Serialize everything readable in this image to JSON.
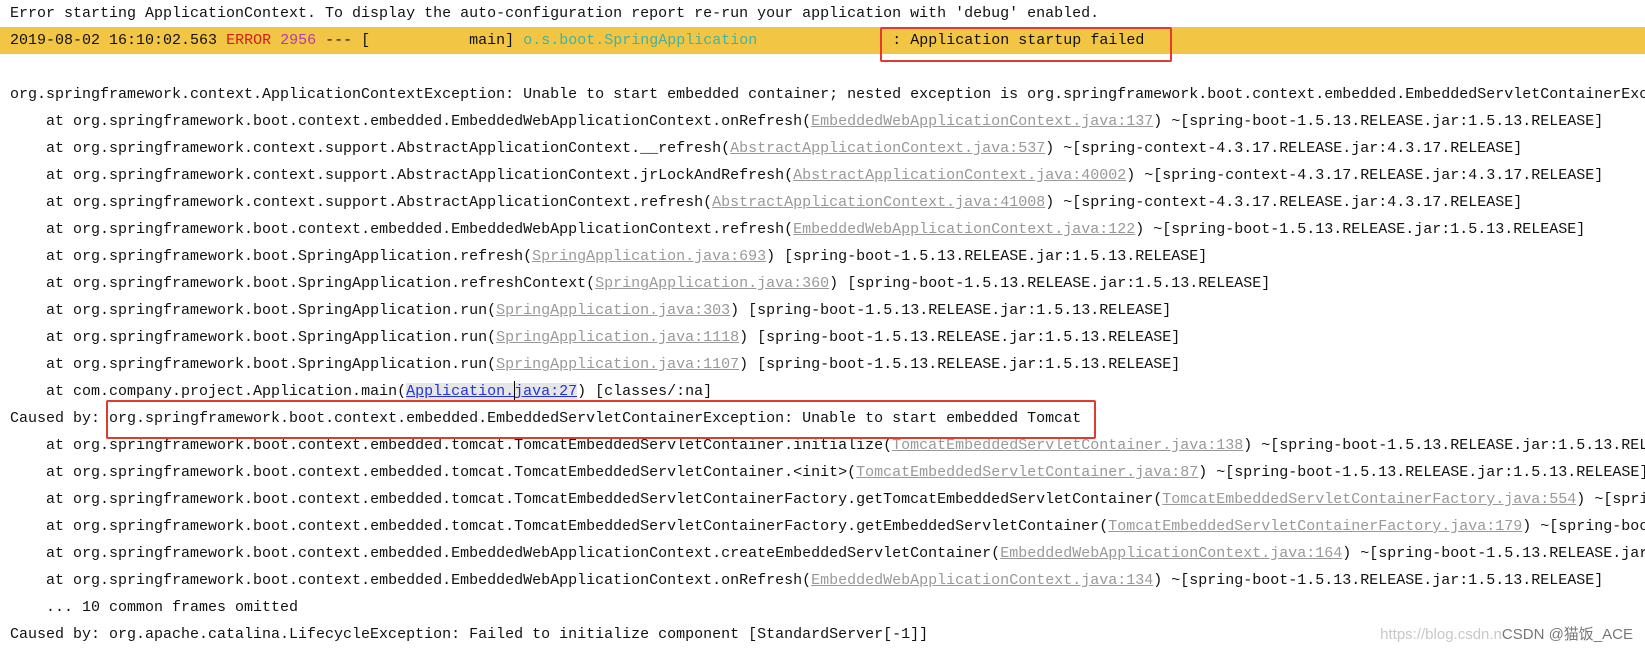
{
  "colors": {
    "highlight": "#f2c544",
    "error": "#cc1f1f",
    "pid": "#b03ab0",
    "logger": "#3fb3a4",
    "link": "#999999",
    "box": "#e23a2e"
  },
  "header_line": "Error starting ApplicationContext. To display the auto-configuration report re-run your application with 'debug' enabled.",
  "log_entry": {
    "timestamp": "2019-08-02 16:10:02.563",
    "level": "ERROR",
    "pid": "2956",
    "sep": "---",
    "thread": "[           main]",
    "logger": "o.s.boot.SpringApplication",
    "message": ": Application startup failed"
  },
  "exception": "org.springframework.context.ApplicationContextException: Unable to start embedded container; nested exception is org.springframework.boot.context.embedded.EmbeddedServletContainerExc",
  "frames1": [
    {
      "method": "org.springframework.boot.context.embedded.EmbeddedWebApplicationContext.onRefresh",
      "file": "EmbeddedWebApplicationContext.java:137",
      "suffix": "~[spring-boot-1.5.13.RELEASE.jar:1.5.13.RELEASE]"
    },
    {
      "method": "org.springframework.context.support.AbstractApplicationContext.__refresh",
      "file": "AbstractApplicationContext.java:537",
      "suffix": "~[spring-context-4.3.17.RELEASE.jar:4.3.17.RELEASE]"
    },
    {
      "method": "org.springframework.context.support.AbstractApplicationContext.jrLockAndRefresh",
      "file": "AbstractApplicationContext.java:40002",
      "suffix": "~[spring-context-4.3.17.RELEASE.jar:4.3.17.RELEASE]"
    },
    {
      "method": "org.springframework.context.support.AbstractApplicationContext.refresh",
      "file": "AbstractApplicationContext.java:41008",
      "suffix": "~[spring-context-4.3.17.RELEASE.jar:4.3.17.RELEASE]"
    },
    {
      "method": "org.springframework.boot.context.embedded.EmbeddedWebApplicationContext.refresh",
      "file": "EmbeddedWebApplicationContext.java:122",
      "suffix": "~[spring-boot-1.5.13.RELEASE.jar:1.5.13.RELEASE]"
    },
    {
      "method": "org.springframework.boot.SpringApplication.refresh",
      "file": "SpringApplication.java:693",
      "suffix": "[spring-boot-1.5.13.RELEASE.jar:1.5.13.RELEASE]"
    },
    {
      "method": "org.springframework.boot.SpringApplication.refreshContext",
      "file": "SpringApplication.java:360",
      "suffix": "[spring-boot-1.5.13.RELEASE.jar:1.5.13.RELEASE]"
    },
    {
      "method": "org.springframework.boot.SpringApplication.run",
      "file": "SpringApplication.java:303",
      "suffix": "[spring-boot-1.5.13.RELEASE.jar:1.5.13.RELEASE]"
    },
    {
      "method": "org.springframework.boot.SpringApplication.run",
      "file": "SpringApplication.java:1118",
      "suffix": "[spring-boot-1.5.13.RELEASE.jar:1.5.13.RELEASE]"
    },
    {
      "method": "org.springframework.boot.SpringApplication.run",
      "file": "SpringApplication.java:1107",
      "suffix": "[spring-boot-1.5.13.RELEASE.jar:1.5.13.RELEASE]"
    }
  ],
  "main_frame": {
    "method": "com.company.project.Application.main",
    "file_a": "Application.",
    "file_b": "java:27",
    "suffix": "[classes/:na]"
  },
  "caused_by_1": {
    "label": "Caused by:",
    "text": "org.springframework.boot.context.embedded.EmbeddedServletContainerException: Unable to start embedded Tomcat"
  },
  "frames2": [
    {
      "method": "org.springframework.boot.context.embedded.tomcat.TomcatEmbeddedServletContainer.initialize",
      "file": "TomcatEmbeddedServletContainer.java:138",
      "suffix": "~[spring-boot-1.5.13.RELEASE.jar:1.5.13.REL"
    },
    {
      "method": "org.springframework.boot.context.embedded.tomcat.TomcatEmbeddedServletContainer.<init>",
      "file": "TomcatEmbeddedServletContainer.java:87",
      "suffix": "~[spring-boot-1.5.13.RELEASE.jar:1.5.13.RELEASE]"
    },
    {
      "method": "org.springframework.boot.context.embedded.tomcat.TomcatEmbeddedServletContainerFactory.getTomcatEmbeddedServletContainer",
      "file": "TomcatEmbeddedServletContainerFactory.java:554",
      "suffix": "~[spri"
    },
    {
      "method": "org.springframework.boot.context.embedded.tomcat.TomcatEmbeddedServletContainerFactory.getEmbeddedServletContainer",
      "file": "TomcatEmbeddedServletContainerFactory.java:179",
      "suffix": "~[spring-boo"
    },
    {
      "method": "org.springframework.boot.context.embedded.EmbeddedWebApplicationContext.createEmbeddedServletContainer",
      "file": "EmbeddedWebApplicationContext.java:164",
      "suffix": "~[spring-boot-1.5.13.RELEASE.jar"
    },
    {
      "method": "org.springframework.boot.context.embedded.EmbeddedWebApplicationContext.onRefresh",
      "file": "EmbeddedWebApplicationContext.java:134",
      "suffix": "~[spring-boot-1.5.13.RELEASE.jar:1.5.13.RELEASE]"
    }
  ],
  "omitted": "... 10 common frames omitted",
  "caused_by_2": "Caused by: org.apache.catalina.LifecycleException: Failed to initialize component [StandardServer[-1]]",
  "watermark": {
    "url": "https://blog.csdn.n",
    "brand": "CSDN @猫饭_ACE"
  }
}
